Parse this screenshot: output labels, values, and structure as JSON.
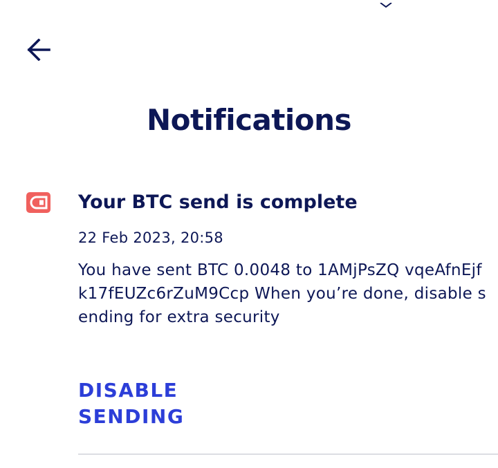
{
  "header": {
    "back_icon": "arrow-left-icon",
    "title": "Notifications"
  },
  "notification": {
    "icon": "wallet-icon",
    "icon_color": "#f0605d",
    "title": "Your BTC send is complete",
    "date": "22 Feb 2023, 20:58",
    "body": "You have sent BTC 0.0048 to 1AMjPsZQ vqeAfnEjfk17fEUZc6rZuM9Ccp When you’re done, disable sending for extra security",
    "action_label": "DISABLE SENDING"
  },
  "colors": {
    "text": "#0d1756",
    "accent": "#2c3ed8",
    "divider": "#dcdde3",
    "background": "#ffffff"
  }
}
